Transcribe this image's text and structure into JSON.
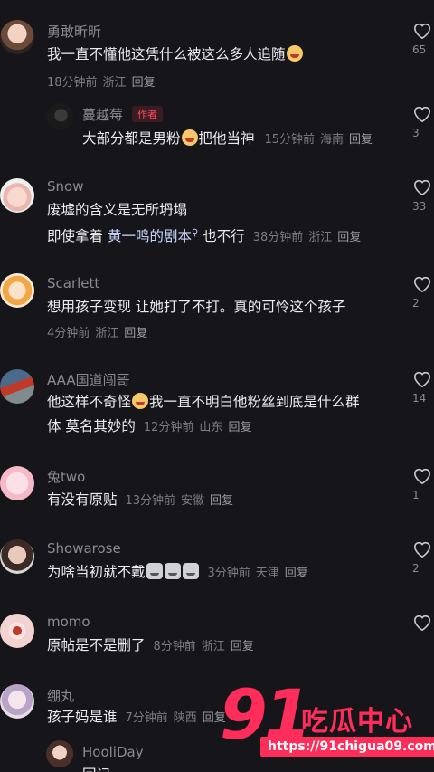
{
  "comments": [
    {
      "user": "勇敢昕昕",
      "text": "我一直不懂他这凭什么被这么多人追随",
      "time": "18分钟前",
      "region": "浙江",
      "reply": "回复",
      "likes": "65"
    },
    {
      "user": "蔓越莓",
      "tag": "作者",
      "text_a": "大部分都是男粉",
      "text_b": "把他当神",
      "time": "15分钟前",
      "region": "海南",
      "reply": "回复",
      "likes": "3"
    },
    {
      "user": "Snow",
      "text": "废墟的含义是无所坍塌",
      "text2_a": "即使拿着",
      "text2_link": "黄一鸣的剧本",
      "text2_b": "也不行",
      "time": "38分钟前",
      "region": "浙江",
      "reply": "回复",
      "likes": "33"
    },
    {
      "user": "Scarlett",
      "text": "想用孩子变现 让她打了不打。真的可怜这个孩子",
      "time": "4分钟前",
      "region": "浙江",
      "reply": "回复",
      "likes": "2"
    },
    {
      "user": "AAA国道闯哥",
      "text_a": "他这样不奇怪",
      "text_b": "我一直不明白他粉丝到底是什么群",
      "text2": "体  莫名其妙的",
      "time": "12分钟前",
      "region": "山东",
      "reply": "回复",
      "likes": "14"
    },
    {
      "user": "兔two",
      "text": "有没有原贴",
      "time": "13分钟前",
      "region": "安徽",
      "reply": "回复",
      "likes": "1"
    },
    {
      "user": "Showarose",
      "text": "为啥当初就不戴",
      "time": "3分钟前",
      "region": "天津",
      "reply": "回复",
      "likes": "2"
    },
    {
      "user": "momo",
      "text": "原帖是不是删了",
      "time": "8分钟前",
      "region": "浙江",
      "reply": "回复",
      "likes": ""
    },
    {
      "user": "绷丸",
      "text": "孩子妈是谁",
      "time": "7分钟前",
      "region": "陕西",
      "reply": "回复",
      "likes": ""
    },
    {
      "user": "HooliDay",
      "text": "回记"
    }
  ],
  "watermark": {
    "brand_num": "91",
    "brand_cn": "吃瓜中心",
    "url": "https://91chigua09.com"
  },
  "colors": {
    "bg": "#16161a",
    "accent": "#ff2d5a",
    "author_tag": "#ff4a5c"
  }
}
